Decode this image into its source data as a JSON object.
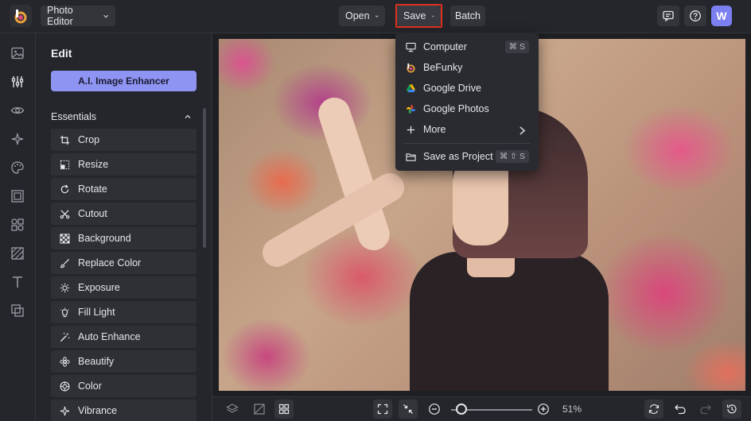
{
  "app": {
    "title": "Photo Editor",
    "avatar_initial": "W",
    "accent": "#8e94f2"
  },
  "topbar": {
    "open_label": "Open",
    "save_label": "Save",
    "batch_label": "Batch",
    "icons": [
      "comment-icon",
      "help-icon"
    ]
  },
  "save_menu": {
    "items": [
      {
        "label": "Computer",
        "icon": "monitor-icon",
        "shortcut": "⌘ S"
      },
      {
        "label": "BeFunky",
        "icon": "befunky-icon",
        "shortcut": ""
      },
      {
        "label": "Google Drive",
        "icon": "google-drive-icon",
        "shortcut": ""
      },
      {
        "label": "Google Photos",
        "icon": "google-photos-icon",
        "shortcut": ""
      },
      {
        "label": "More",
        "icon": "plus-icon",
        "shortcut": ""
      },
      {
        "label": "Save as Project",
        "icon": "folder-icon",
        "shortcut": "⌘ ⇧ S"
      }
    ]
  },
  "rail": {
    "icons": [
      "image-icon",
      "sliders-icon",
      "eye-icon",
      "sparkle-icon",
      "palette-icon",
      "frame-icon",
      "shapes-icon",
      "texture-icon",
      "text-icon",
      "layers-overlay-icon"
    ]
  },
  "panel": {
    "title": "Edit",
    "ai_button": "A.I. Image Enhancer",
    "section": "Essentials",
    "tools": [
      {
        "label": "Crop",
        "icon": "crop-icon"
      },
      {
        "label": "Resize",
        "icon": "resize-icon"
      },
      {
        "label": "Rotate",
        "icon": "rotate-icon"
      },
      {
        "label": "Cutout",
        "icon": "scissors-icon"
      },
      {
        "label": "Background",
        "icon": "checker-icon"
      },
      {
        "label": "Replace Color",
        "icon": "brush-icon"
      },
      {
        "label": "Exposure",
        "icon": "sun-icon"
      },
      {
        "label": "Fill Light",
        "icon": "bulb-icon"
      },
      {
        "label": "Auto Enhance",
        "icon": "magic-wand-icon"
      },
      {
        "label": "Beautify",
        "icon": "flower-icon"
      },
      {
        "label": "Color",
        "icon": "color-wheel-icon"
      },
      {
        "label": "Vibrance",
        "icon": "vibrance-icon"
      }
    ]
  },
  "bottombar": {
    "zoom_label": "51%",
    "zoom_level": 0.51
  }
}
